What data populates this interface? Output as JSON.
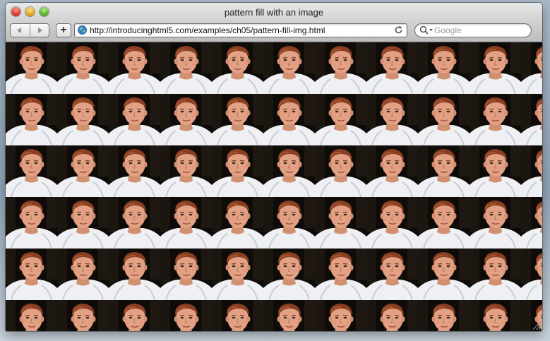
{
  "window": {
    "title": "pattern fill with an image"
  },
  "toolbar": {
    "back_icon": "back-arrow-icon",
    "forward_icon": "forward-arrow-icon",
    "add_bookmark_label": "+",
    "url": "http://introducinghtml5.com/examples/ch05/pattern-fill-img.html",
    "reload_icon": "reload-icon",
    "search_placeholder": "Google"
  },
  "content": {
    "pattern_tile": "portrait-photo",
    "columns_visible": 11,
    "rows_visible": 6
  },
  "colors": {
    "chrome_top": "#e8e8e8",
    "chrome_bottom": "#bdbdbd",
    "photo_background": "#0e0b08",
    "shirt": "#f2f4f6",
    "skin": "#e2a184",
    "hair": "#8a3f22"
  }
}
